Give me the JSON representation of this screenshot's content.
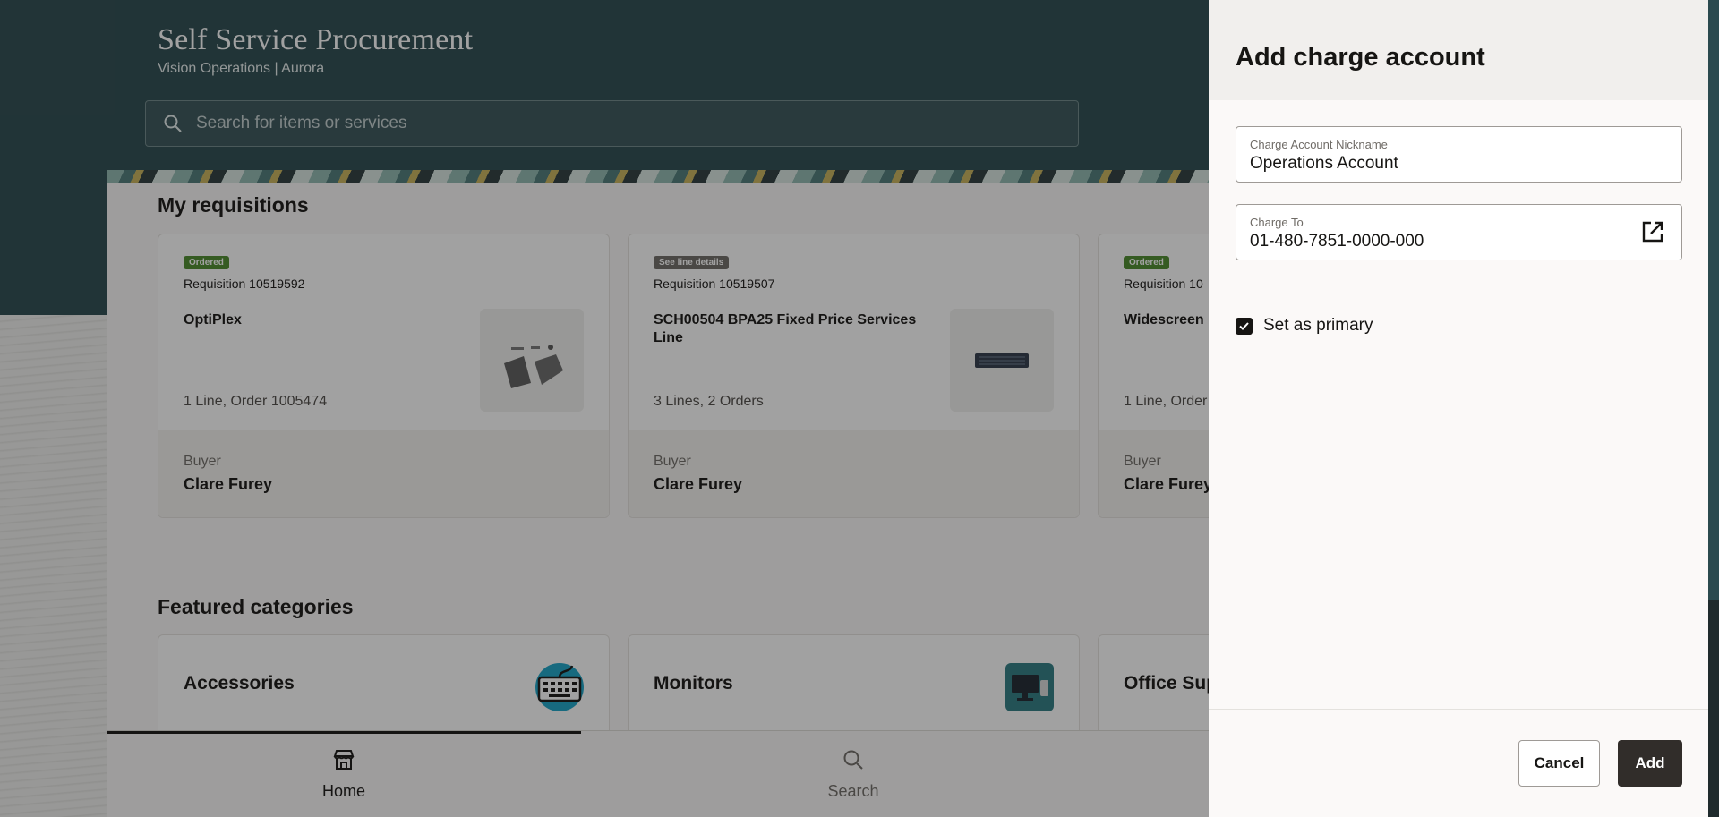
{
  "app": {
    "title": "Self Service Procurement",
    "subtitle": "Vision Operations | Aurora"
  },
  "search": {
    "placeholder": "Search for items or services",
    "icon": "search-icon"
  },
  "requisitions": {
    "title": "My requisitions",
    "cards": [
      {
        "status": "Ordered",
        "number": "Requisition 10519592",
        "item": "OptiPlex",
        "lines": "1 Line, Order 1005474",
        "buyer_label": "Buyer",
        "buyer": "Clare Furey"
      },
      {
        "status": "See line details",
        "number": "Requisition 10519507",
        "item": "SCH00504 BPA25 Fixed Price Services Line",
        "lines": "3 Lines, 2 Orders",
        "buyer_label": "Buyer",
        "buyer": "Clare Furey"
      },
      {
        "status": "Ordered",
        "number": "Requisition 10",
        "item": "Widescreen",
        "lines": "1 Line, Order",
        "buyer_label": "Buyer",
        "buyer": "Clare Furey"
      }
    ]
  },
  "categories": {
    "title": "Featured categories",
    "items": [
      {
        "label": "Accessories",
        "icon": "keyboard-icon"
      },
      {
        "label": "Monitors",
        "icon": "monitor-icon"
      },
      {
        "label": "Office Sup"
      }
    ]
  },
  "nav": {
    "items": [
      {
        "label": "Home",
        "icon": "store-icon",
        "active": true
      },
      {
        "label": "Search",
        "icon": "search-icon",
        "active": false
      }
    ]
  },
  "drawer": {
    "title": "Add charge account",
    "nickname": {
      "label": "Charge Account Nickname",
      "value": "Operations Account"
    },
    "charge_to": {
      "label": "Charge To",
      "value": "01-480-7851-0000-000"
    },
    "primary": {
      "label": "Set as primary",
      "checked": true
    },
    "cancel_label": "Cancel",
    "add_label": "Add"
  },
  "colors": {
    "header": "#2b4a4f",
    "primary_button": "#312d2a",
    "ordered_badge": "#4c8a2c",
    "details_badge": "#6f6b66"
  }
}
